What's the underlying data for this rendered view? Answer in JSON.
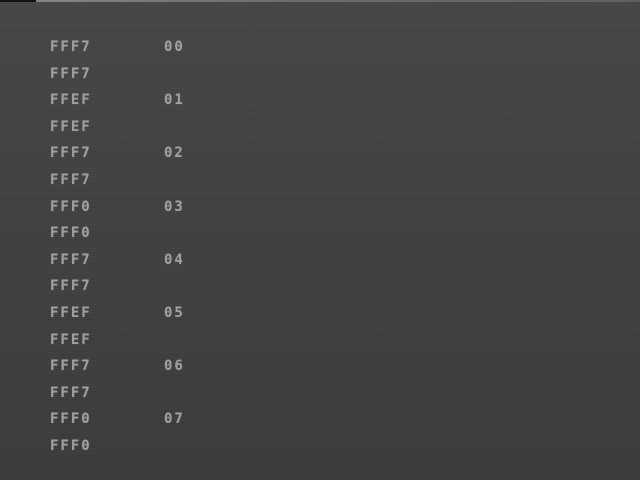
{
  "rows": [
    {
      "address": "FFF7",
      "index": "00"
    },
    {
      "address": "FFF7",
      "index": ""
    },
    {
      "address": "FFEF",
      "index": "01"
    },
    {
      "address": "FFEF",
      "index": ""
    },
    {
      "address": "FFF7",
      "index": "02"
    },
    {
      "address": "FFF7",
      "index": ""
    },
    {
      "address": "FFF0",
      "index": "03"
    },
    {
      "address": "FFF0",
      "index": ""
    },
    {
      "address": "FFF7",
      "index": "04"
    },
    {
      "address": "FFF7",
      "index": ""
    },
    {
      "address": "FFEF",
      "index": "05"
    },
    {
      "address": "FFEF",
      "index": ""
    },
    {
      "address": "FFF7",
      "index": "06"
    },
    {
      "address": "FFF7",
      "index": ""
    },
    {
      "address": "FFF0",
      "index": "07"
    },
    {
      "address": "FFF0",
      "index": ""
    }
  ],
  "colors": {
    "background": "#404040",
    "text": "#a8a8a8",
    "top_highlight": "#8c8c8c"
  }
}
